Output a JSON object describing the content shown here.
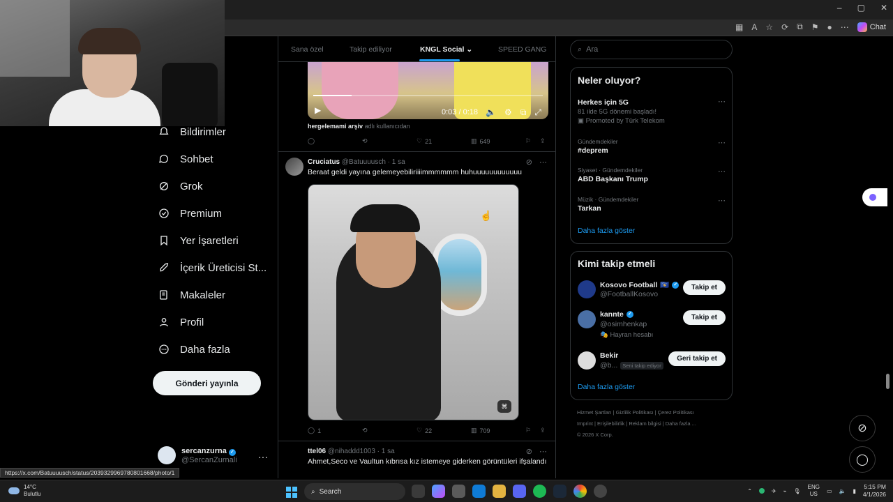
{
  "browser": {
    "window_controls": [
      "–",
      "▢",
      "✕"
    ],
    "chat_label": "Chat",
    "status_url": "https://x.com/Batuuuusch/status/2039329969780801668/photo/1"
  },
  "sidebar": {
    "items": [
      {
        "label": "Bildirimler",
        "icon": "bell-icon"
      },
      {
        "label": "Sohbet",
        "icon": "chat-bubble-icon"
      },
      {
        "label": "Grok",
        "icon": "grok-icon"
      },
      {
        "label": "Premium",
        "icon": "premium-badge-icon"
      },
      {
        "label": "Yer İşaretleri",
        "icon": "bookmark-icon"
      },
      {
        "label": "İçerik Üreticisi St...",
        "icon": "rocket-icon"
      },
      {
        "label": "Makaleler",
        "icon": "articles-icon"
      },
      {
        "label": "Profil",
        "icon": "person-icon"
      },
      {
        "label": "Daha fazla",
        "icon": "more-circle-icon"
      }
    ],
    "post_button": "Gönderi yayınla",
    "account": {
      "name": "sercanzurna",
      "handle": "@SercanZurnali",
      "more": "···"
    }
  },
  "feed": {
    "tabs": [
      "Sana özel",
      "Takip ediliyor",
      "KNGL Social",
      "SPEED GANG"
    ],
    "active_tab": "KNGL Social",
    "video": {
      "time": "0:03 / 0:18",
      "progress": 0.167
    },
    "video_attribution": {
      "name": "hergelemami arşiv",
      "suffix": "adlı kullanıcıdan"
    },
    "video_actions": {
      "replies": "",
      "reposts": "",
      "likes": "21",
      "views": "649"
    },
    "tweet1": {
      "name": "Cruciatus",
      "handle": "@Batuuuusch · 1 sa",
      "text": "Beraat geldi yayına gelemeyebiliriiiimmmmmm huhuuuuuuuuuuuu",
      "actions": {
        "replies": "1",
        "reposts": "",
        "likes": "22",
        "views": "709"
      }
    },
    "tweet2": {
      "name": "ttel06",
      "handle": "@nihaddd1003 · 1 sa",
      "text": "Ahmet,Seco ve Vaultun kıbrısa kız istemeye giderken görüntüleri ifşalandı"
    }
  },
  "right": {
    "search_placeholder": "Ara",
    "trends_title": "Neler oluyor?",
    "trends": [
      {
        "category": "",
        "name": "Herkes için 5G",
        "sub": "81 ilde 5G dönemi başladı!",
        "promo": "Promoted by Türk Telekom"
      },
      {
        "category": "Gündemdekiler",
        "name": "#deprem",
        "sub": "",
        "promo": ""
      },
      {
        "category": "Siyaset · Gündemdekiler",
        "name": "ABD Başkanı Trump",
        "sub": "",
        "promo": ""
      },
      {
        "category": "Müzik · Gündemdekiler",
        "name": "Tarkan",
        "sub": "",
        "promo": ""
      }
    ],
    "trends_show_more": "Daha fazla göster",
    "follow_title": "Kimi takip etmeli",
    "follow": [
      {
        "name": "Kosovo Football",
        "handle": "@FootballKosovo",
        "extra": "",
        "button": "Takip et"
      },
      {
        "name": "kannte",
        "handle": "@osimhenkap",
        "extra": "Hayran hesabı",
        "button": "Takip et"
      },
      {
        "name": "Bekir",
        "handle": "@b...",
        "extra": "",
        "badge": "Seni takip ediyor",
        "button": "Geri takip et"
      }
    ],
    "follow_show_more": "Daha fazla göster",
    "footer": [
      "Hizmet Şartları",
      "Gizlilik Politikası",
      "Çerez Politikası",
      "Imprint",
      "Erişilebilirlik",
      "Reklam bilgisi",
      "Daha fazla ...",
      "© 2026 X Corp."
    ]
  },
  "taskbar": {
    "weather_temp": "14°C",
    "weather_desc": "Bulutlu",
    "search_label": "Search",
    "lang_1": "ENG",
    "lang_2": "US",
    "time": "5:15 PM",
    "date": "4/1/2026"
  }
}
